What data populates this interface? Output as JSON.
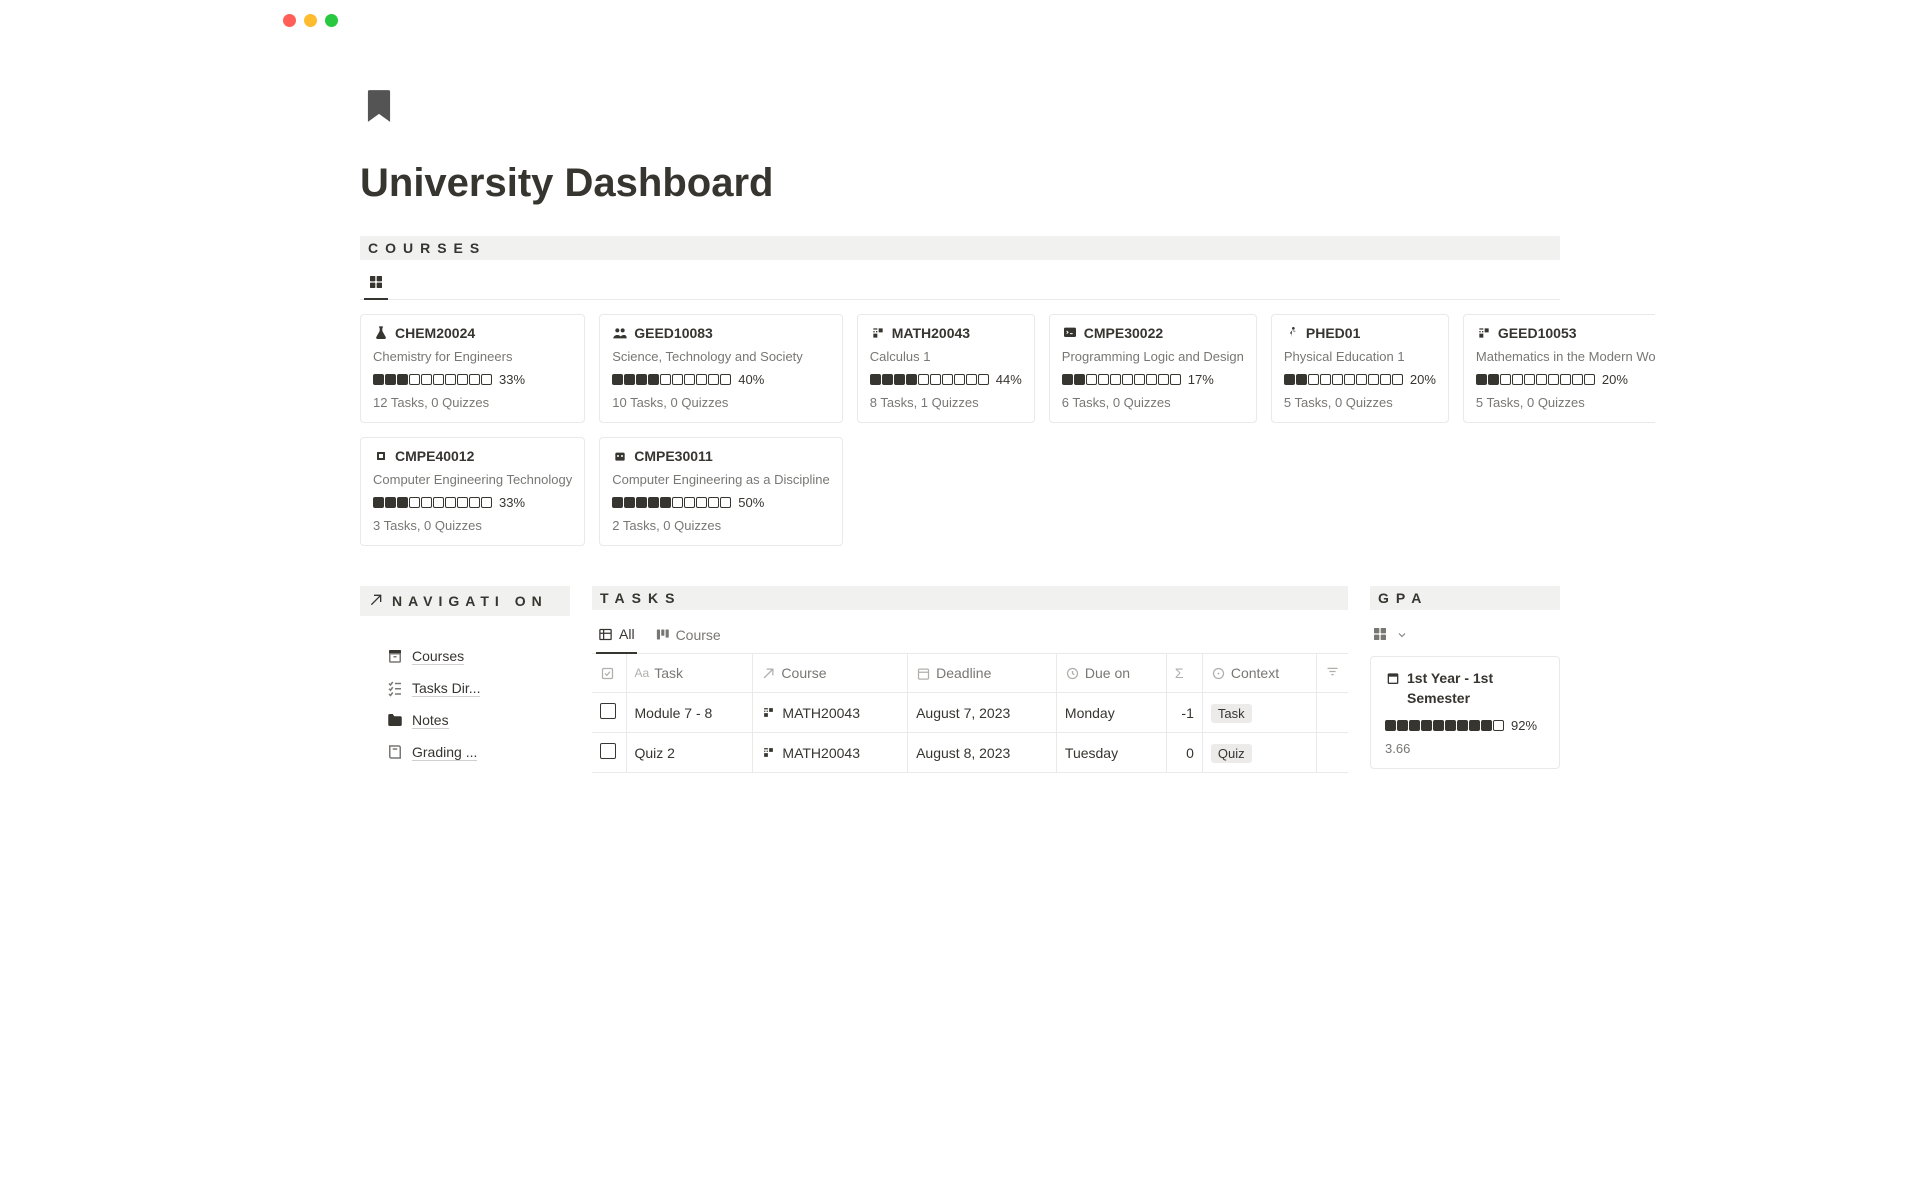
{
  "page_title": "University Dashboard",
  "sections": {
    "courses": {
      "label": "COURSES"
    },
    "tasks": {
      "label": "TASKS"
    },
    "gpa": {
      "label": "GPA"
    },
    "navigation": {
      "label": "NAVIGATI  ON"
    }
  },
  "courses": [
    {
      "code": "CHEM20024",
      "name": "Chemistry for Engineers",
      "filled": 3,
      "pct": "33%",
      "meta": "12 Tasks, 0 Quizzes",
      "icon": "flask"
    },
    {
      "code": "GEED10083",
      "name": "Science, Technology and Society",
      "filled": 4,
      "pct": "40%",
      "meta": "10 Tasks, 0 Quizzes",
      "icon": "people"
    },
    {
      "code": "MATH20043",
      "name": "Calculus 1",
      "filled": 4,
      "pct": "44%",
      "meta": "8 Tasks, 1 Quizzes",
      "icon": "calc"
    },
    {
      "code": "CMPE30022",
      "name": "Programming Logic and Design",
      "filled": 2,
      "pct": "17%",
      "meta": "6 Tasks, 0 Quizzes",
      "icon": "code"
    },
    {
      "code": "PHED01",
      "name": "Physical Education 1",
      "filled": 2,
      "pct": "20%",
      "meta": "5 Tasks, 0 Quizzes",
      "icon": "run"
    },
    {
      "code": "GEED10053",
      "name": "Mathematics in the Modern World",
      "filled": 2,
      "pct": "20%",
      "meta": "5 Tasks, 0 Quizzes",
      "icon": "calc"
    },
    {
      "code": "CMPE40012",
      "name": "Computer Engineering Technology",
      "filled": 3,
      "pct": "33%",
      "meta": "3 Tasks, 0 Quizzes",
      "icon": "chip"
    },
    {
      "code": "CMPE30011",
      "name": "Computer Engineering as a Discipline",
      "filled": 5,
      "pct": "50%",
      "meta": "2 Tasks, 0 Quizzes",
      "icon": "robot"
    }
  ],
  "nav_items": [
    {
      "label": "Courses",
      "icon": "archive"
    },
    {
      "label": "Tasks Dir...",
      "icon": "checklist"
    },
    {
      "label": "Notes",
      "icon": "folder"
    },
    {
      "label": "Grading ...",
      "icon": "book"
    }
  ],
  "task_tabs": {
    "all": "All",
    "course": "Course"
  },
  "task_columns": {
    "task": "Task",
    "course": "Course",
    "deadline": "Deadline",
    "due": "Due on",
    "context": "Context"
  },
  "tasks": [
    {
      "name": "Module 7 - 8",
      "course": "MATH20043",
      "deadline": "August 7, 2023",
      "due": "Monday",
      "sigma": "-1",
      "context": "Task"
    },
    {
      "name": "Quiz 2",
      "course": "MATH20043",
      "deadline": "August 8, 2023",
      "due": "Tuesday",
      "sigma": "0",
      "context": "Quiz"
    }
  ],
  "gpa_card": {
    "title": "1st Year - 1st Semester",
    "pct": "92%",
    "filled": 9,
    "value": "3.66"
  }
}
